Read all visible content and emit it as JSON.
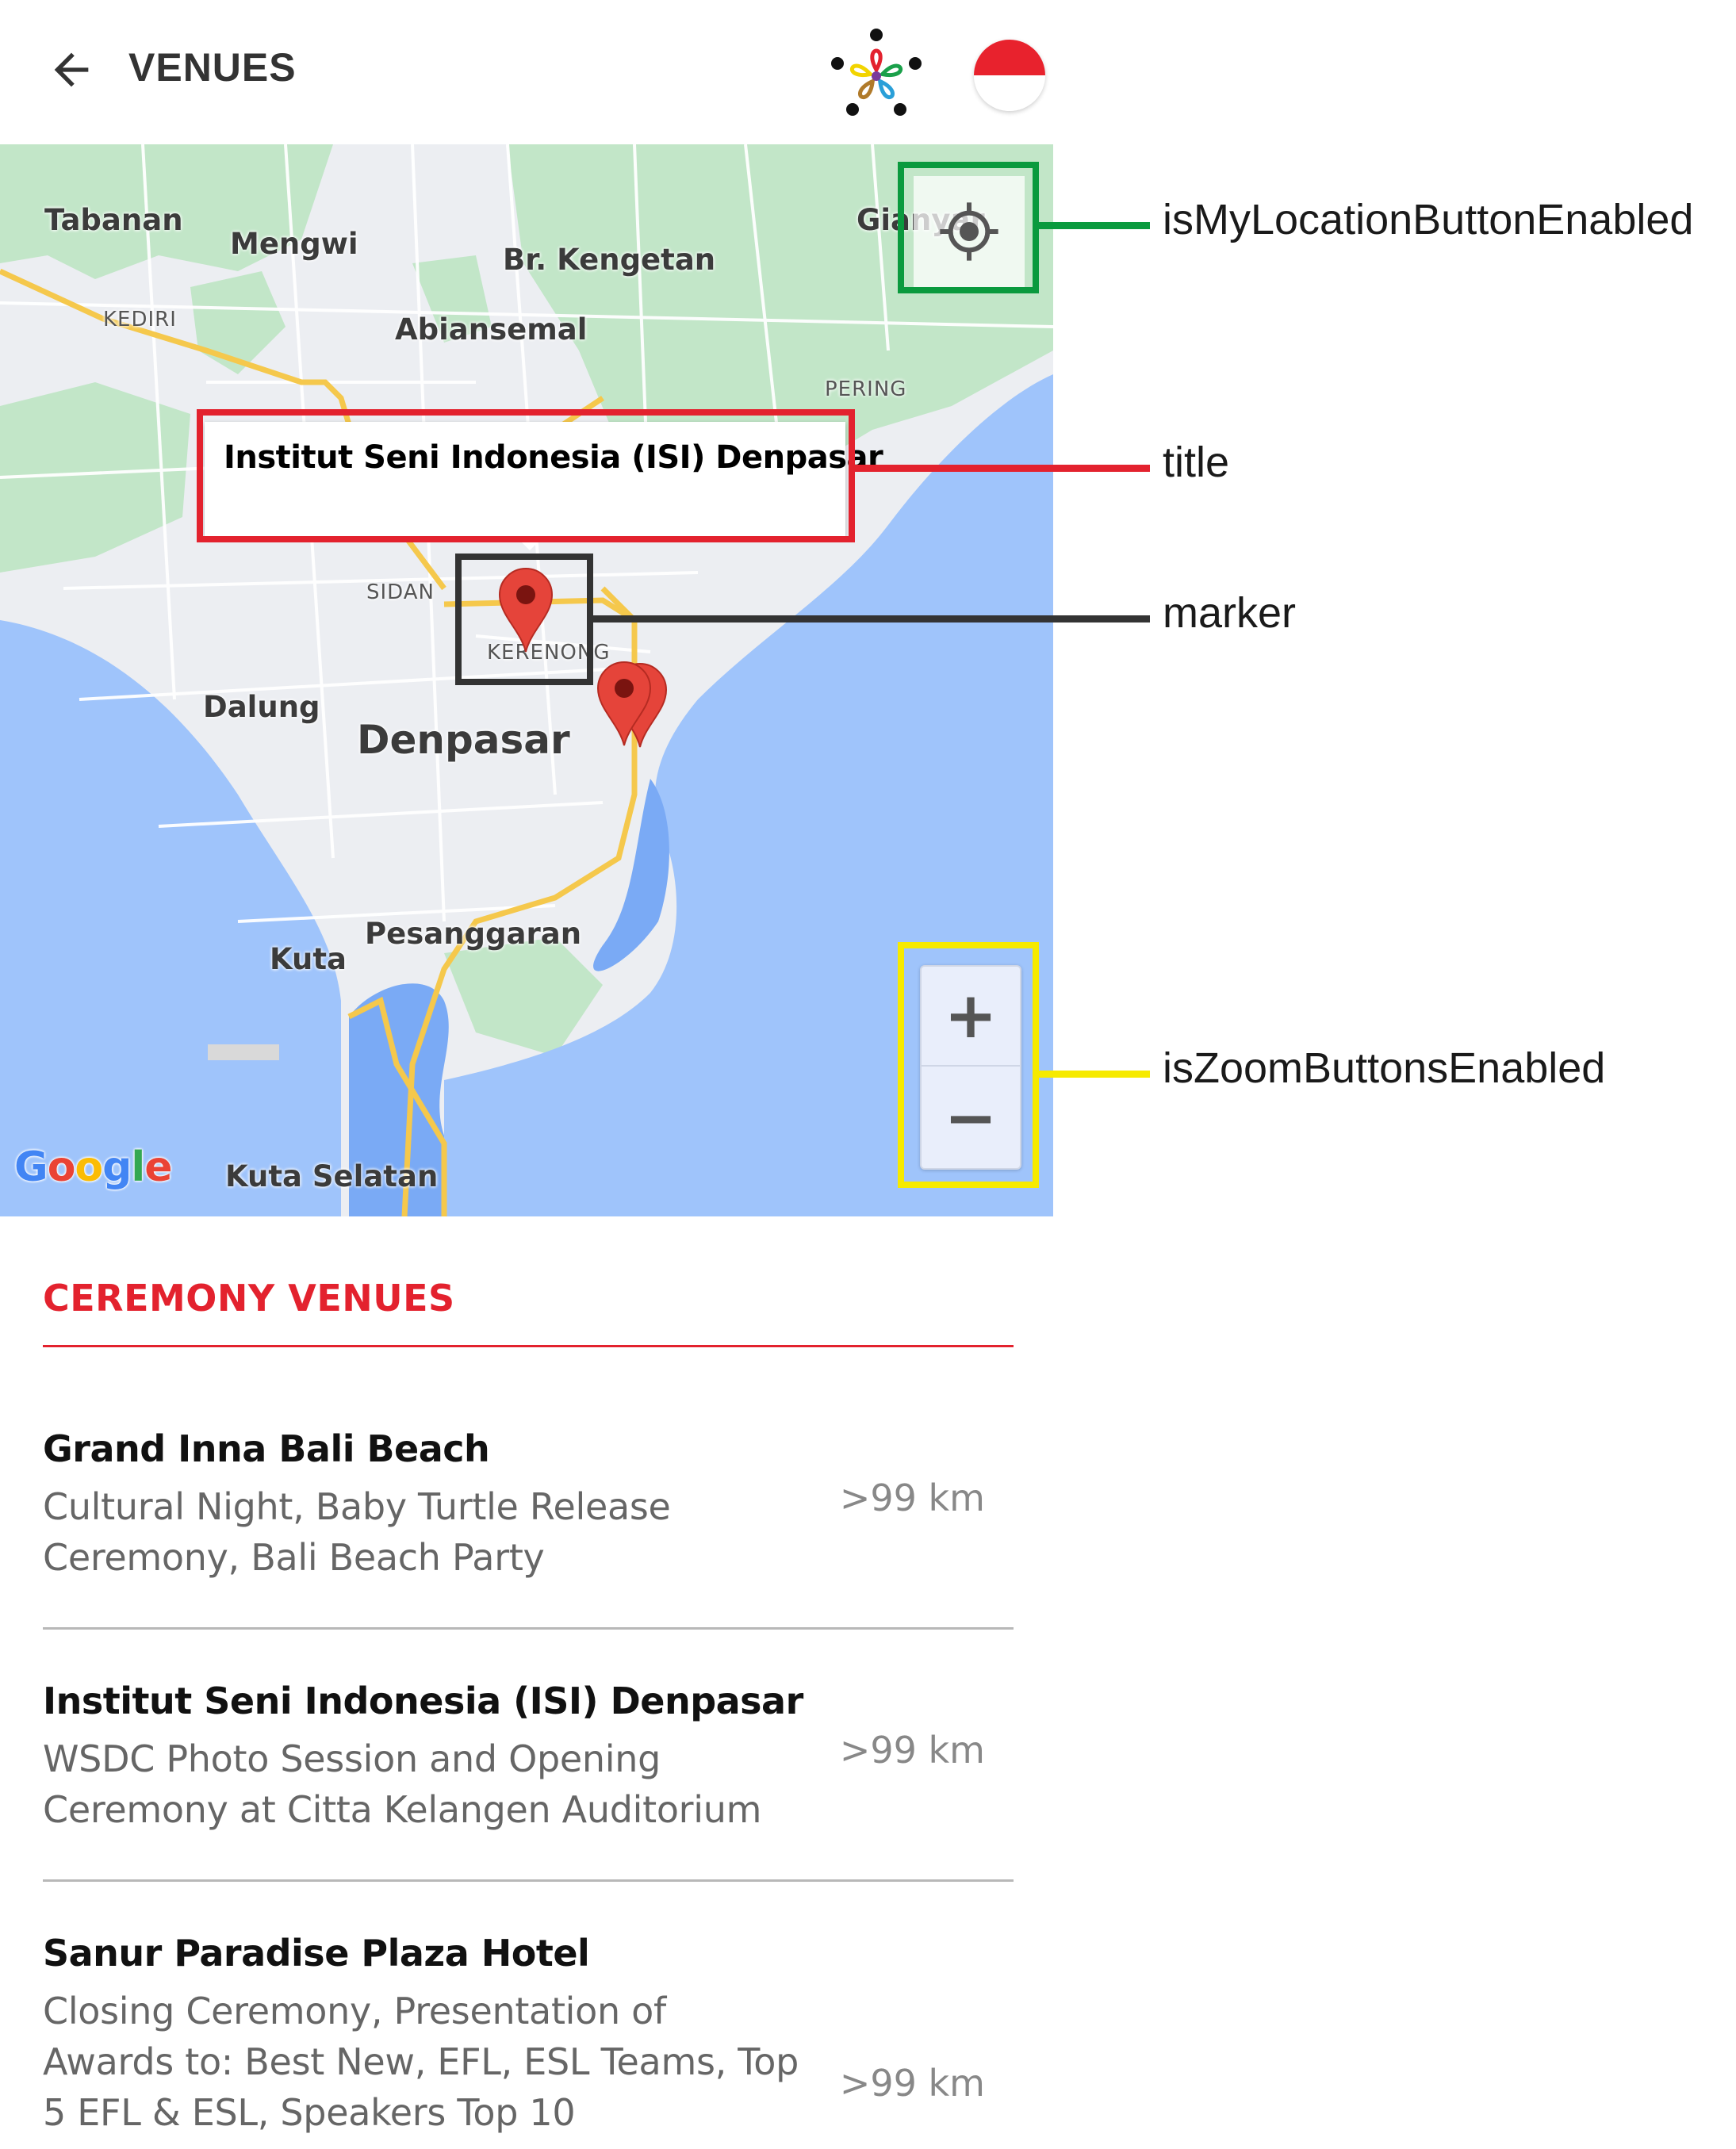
{
  "appbar": {
    "title": "VENUES"
  },
  "map": {
    "labels": {
      "tabanan": "Tabanan",
      "mengwi": "Mengwi",
      "br_kengetan": "Br. Kengetan",
      "kediri": "KEDIRI",
      "abiansemal": "Abiansemal",
      "gianyar": "Gianyar",
      "pering": "PERING",
      "sidan": "SIDAN",
      "kerenong": "KERENONG",
      "dalung": "Dalung",
      "denpasar": "Denpasar",
      "kuta": "Kuta",
      "pesanggaran": "Pesanggaran",
      "kuta_selatan": "Kuta Selatan"
    },
    "info_window_title": "Institut Seni Indonesia (ISI) Denpasar",
    "zoom_in": "+",
    "zoom_out": "−",
    "google_logo": "Google",
    "colors": {
      "land": "#eceef2",
      "park": "#c2e6c8",
      "water": "#9fc4fb",
      "road": "#f5c84c",
      "marker": "#e5443a"
    }
  },
  "annotations": {
    "my_location": {
      "label": "isMyLocationButtonEnabled",
      "color": "#0a9a3e"
    },
    "title": {
      "label": "title",
      "color": "#e3222e"
    },
    "marker": {
      "label": "marker",
      "color": "#333333"
    },
    "zoom": {
      "label": "isZoomButtonsEnabled",
      "color": "#f6ea00"
    }
  },
  "venues": {
    "section_title": "CEREMONY VENUES",
    "items": [
      {
        "name": "Grand Inna Bali Beach",
        "description": "Cultural Night, Baby Turtle Release Ceremony, Bali Beach Party",
        "distance": ">99 km"
      },
      {
        "name": "Institut Seni Indonesia (ISI) Denpasar",
        "description": "WSDC Photo Session and Opening Ceremony at Citta Kelangen Auditorium",
        "distance": ">99 km"
      },
      {
        "name": "Sanur Paradise Plaza Hotel",
        "description": "Closing Ceremony, Presentation of Awards to: Best New, EFL, ESL Teams, Top 5 EFL & ESL, Speakers Top 10",
        "distance": ">99 km"
      }
    ]
  }
}
